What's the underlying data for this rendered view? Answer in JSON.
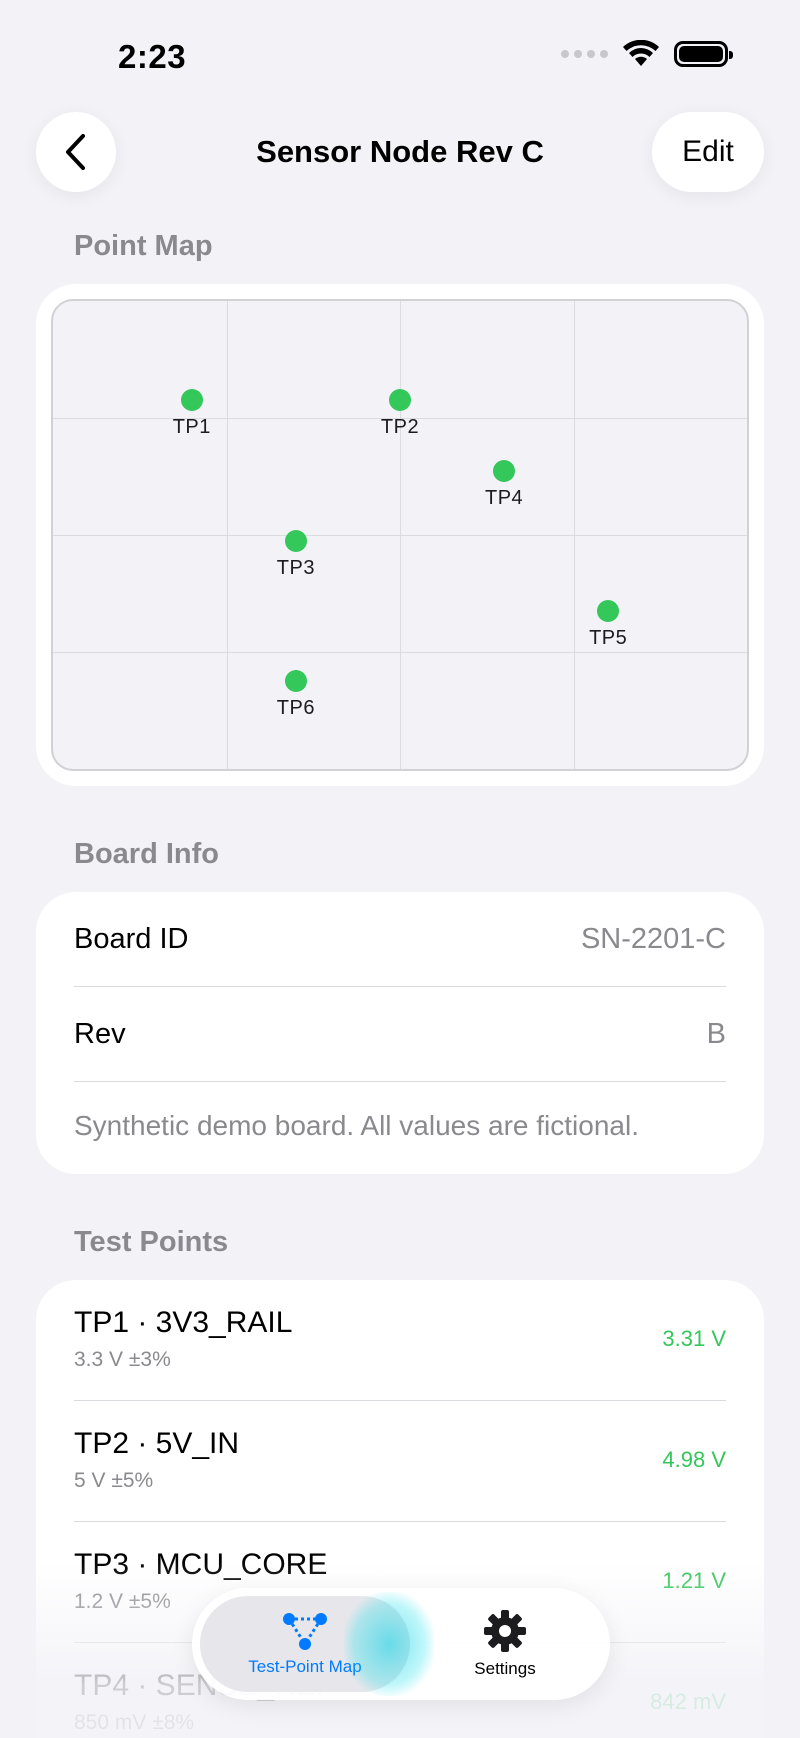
{
  "status_bar": {
    "time": "2:23"
  },
  "nav": {
    "title": "Sensor Node Rev C",
    "edit_label": "Edit"
  },
  "point_map": {
    "header": "Point Map",
    "points": [
      {
        "label": "TP1",
        "col": 0.8,
        "row": 0.85
      },
      {
        "label": "TP2",
        "col": 2.0,
        "row": 0.85
      },
      {
        "label": "TP3",
        "col": 1.4,
        "row": 2.05
      },
      {
        "label": "TP4",
        "col": 2.6,
        "row": 1.45
      },
      {
        "label": "TP5",
        "col": 3.2,
        "row": 2.65
      },
      {
        "label": "TP6",
        "col": 1.4,
        "row": 3.25
      }
    ]
  },
  "board_info": {
    "header": "Board Info",
    "rows": [
      {
        "label": "Board ID",
        "value": "SN-2201-C"
      },
      {
        "label": "Rev",
        "value": "B"
      }
    ],
    "note": "Synthetic demo board. All values are fictional."
  },
  "test_points": {
    "header": "Test Points",
    "items": [
      {
        "name": "TP1 · 3V3_RAIL",
        "spec": "3.3 V ±3%",
        "reading": "3.31 V"
      },
      {
        "name": "TP2 · 5V_IN",
        "spec": "5 V ±5%",
        "reading": "4.98 V"
      },
      {
        "name": "TP3 · MCU_CORE",
        "spec": "1.2 V ±5%",
        "reading": "1.21 V"
      },
      {
        "name": "TP4 · SENSE_REF",
        "spec": "850 mV ±8%",
        "reading": "842 mV"
      }
    ]
  },
  "tab_bar": {
    "tabs": [
      {
        "label": "Test-Point Map",
        "icon": "test-point-map-icon",
        "selected": true
      },
      {
        "label": "Settings",
        "icon": "gear-icon",
        "selected": false
      }
    ]
  },
  "colors": {
    "accent": "#007aff",
    "point": "#34c759",
    "reading": "#34c759",
    "background": "#f2f2f7"
  }
}
